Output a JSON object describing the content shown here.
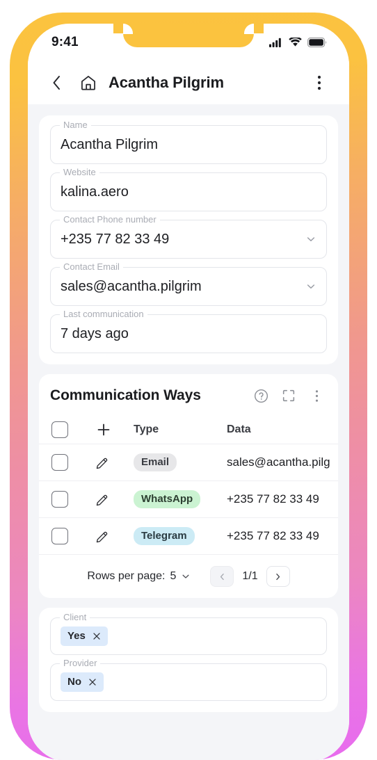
{
  "status_bar": {
    "time": "9:41",
    "icons": [
      "cellular-signal-icon",
      "wifi-icon",
      "battery-icon"
    ]
  },
  "app_bar": {
    "back_icon": "chevron-left-icon",
    "home_icon": "home-icon",
    "title": "Acantha Pilgrim",
    "menu_icon": "more-vertical-icon"
  },
  "details_card": {
    "fields": [
      {
        "label": "Name",
        "value": "Acantha Pilgrim",
        "has_chevron": false
      },
      {
        "label": "Website",
        "value": "kalina.aero",
        "has_chevron": false
      },
      {
        "label": "Contact Phone number",
        "value": "+235 77 82 33 49",
        "has_chevron": true
      },
      {
        "label": "Contact Email",
        "value": "sales@acantha.pilgrim",
        "has_chevron": true
      },
      {
        "label": "Last communication",
        "value": "7 days ago",
        "has_chevron": false
      }
    ]
  },
  "communication_card": {
    "title": "Communication Ways",
    "header_icons": [
      "help-circle-icon",
      "fullscreen-icon",
      "more-vertical-icon"
    ],
    "table": {
      "columns": [
        "",
        "",
        "Type",
        "Data"
      ],
      "add_icon": "plus-icon",
      "rows": [
        {
          "type": "Email",
          "type_color": "#E7E7E9",
          "data": "sales@acantha.pilg",
          "edit_icon": "pencil-icon"
        },
        {
          "type": "WhatsApp",
          "type_color": "#CBF3D2",
          "data": "+235 77 82 33 49",
          "edit_icon": "pencil-icon"
        },
        {
          "type": "Telegram",
          "type_color": "#CCEBF5",
          "data": "+235 77 82 33 49",
          "edit_icon": "pencil-icon"
        }
      ]
    },
    "pagination": {
      "rows_per_page_label": "Rows per page:",
      "rows_per_page_value": "5",
      "page_indicator": "1/1",
      "prev_icon": "chevron-left-icon",
      "next_icon": "chevron-right-icon"
    }
  },
  "flags_card": {
    "fields": [
      {
        "label": "Client",
        "chip": "Yes",
        "remove_icon": "close-icon"
      },
      {
        "label": "Provider",
        "chip": "No",
        "remove_icon": "close-icon"
      }
    ]
  },
  "colors": {
    "frame_top": "#FBC33F",
    "frame_mid": "#F0978F",
    "frame_bottom": "#E86BEE",
    "page_background": "#F4F5F8",
    "card_background": "#FFFFFF",
    "chip_blue": "#DCEAFB"
  }
}
